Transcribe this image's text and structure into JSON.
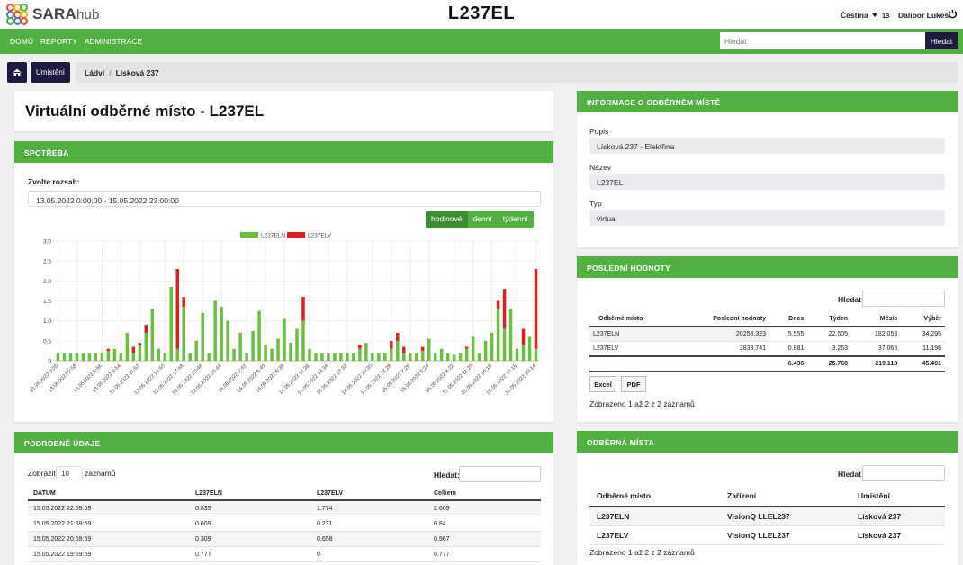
{
  "header": {
    "logo_strong": "SARA",
    "logo_light": "hub",
    "title": "L237EL",
    "language": "Čeština",
    "notification_count": "13",
    "user_name": "Dalibor Lukeš"
  },
  "nav": {
    "items": [
      "DOMŮ",
      "REPORTY",
      "ADMINISTRACE"
    ],
    "search_placeholder": "Hledat",
    "search_button": "Hledat"
  },
  "breadcrumb": {
    "locations_button": "Umístění",
    "items": [
      "Ládví",
      "Lísková 237"
    ]
  },
  "main": {
    "page_title": "Virtuální odběrné místo - L237EL"
  },
  "consumption": {
    "header": "SPOTŘEBA",
    "range_label": "Zvolte rozsah:",
    "range_value": "13.05.2022 0:00:00 - 15.05.2022 23:00:00",
    "toggles": [
      "hodinové",
      "denní",
      "týdenní"
    ],
    "active_toggle": "hodinové"
  },
  "chart_data": {
    "type": "bar",
    "stacked": true,
    "series": [
      {
        "name": "L237ELN",
        "color": "#6abf40",
        "values": [
          0.2,
          0.2,
          0.2,
          0.2,
          0.2,
          0.2,
          0.2,
          0.2,
          0.25,
          0.3,
          0.2,
          0.7,
          0.2,
          0.4,
          0.7,
          1.3,
          0.3,
          0.2,
          1.85,
          0.3,
          1.35,
          0.2,
          0.5,
          1.2,
          0.2,
          1.5,
          1.35,
          1.0,
          0.3,
          0.7,
          0.2,
          0.75,
          1.25,
          0.4,
          0.3,
          0.55,
          1.05,
          0.45,
          0.8,
          1.0,
          0.3,
          0.2,
          0.2,
          0.2,
          0.2,
          0.2,
          0.2,
          0.2,
          0.3,
          0.45,
          0.2,
          0.2,
          0.2,
          0.3,
          0.5,
          0.2,
          0.2,
          0.2,
          0.25,
          0.55,
          0.2,
          0.3,
          0.2,
          0.15,
          0.2,
          0.3,
          0.6,
          0.2,
          0.5,
          0.7,
          1.3,
          0.8,
          1.3,
          0.3,
          0.4,
          0.6,
          0.3
        ],
        "notes": "approximate hourly values"
      },
      {
        "name": "L237ELV",
        "color": "#e02020",
        "values": [
          0,
          0,
          0,
          0,
          0,
          0,
          0,
          0,
          0.05,
          0,
          0,
          0,
          0.15,
          0.05,
          0.2,
          0,
          0,
          0,
          0,
          2.0,
          0.25,
          0,
          0,
          0,
          0,
          0,
          0,
          0,
          0,
          0,
          0,
          0,
          0,
          0,
          0,
          0,
          0,
          0,
          0,
          0.6,
          0,
          0,
          0,
          0,
          0,
          0,
          0,
          0,
          0.1,
          0,
          0,
          0,
          0,
          0.2,
          0.2,
          0.15,
          0,
          0,
          0.1,
          0,
          0,
          0,
          0,
          0,
          0,
          0.05,
          0,
          0,
          0,
          0,
          0.2,
          1.0,
          0,
          0,
          0.4,
          0,
          2.0
        ],
        "notes": ""
      }
    ],
    "x_tick_labels": [
      "13.05.2022 0:00",
      "13.05.2022 2:58",
      "13.05.2022 5:56",
      "13.05.2022 8:54",
      "13.05.2022 11:52",
      "13.05.2022 14:50",
      "13.05.2022 17:48",
      "13.05.2022 20:46",
      "13.05.2022 23:44",
      "14.05.2022 2:42",
      "14.05.2022 5:40",
      "14.05.2022 8:38",
      "14.05.2022 11:36",
      "14.05.2022 14:34",
      "14.05.2022 17:32",
      "14.05.2022 20:30",
      "14.05.2022 23:28",
      "15.05.2022 2:26",
      "15.05.2022 5:24",
      "15.05.2022 8:22",
      "15.05.2022 11:20",
      "15.05.2022 14:18",
      "15.05.2022 17:16",
      "15.05.2022 20:14"
    ],
    "y_ticks": [
      "0",
      "0.5",
      "1.0",
      "1.5",
      "2.0",
      "2.5",
      "3.0"
    ],
    "ylim": [
      0,
      3.0
    ],
    "legend_position": "top-center"
  },
  "details": {
    "header": "PODROBNÉ ÚDAJE",
    "show_label": "Zobrazit",
    "page_size": "10",
    "records_label": "záznamů",
    "search_label": "Hledat:",
    "columns": [
      "DATUM",
      "L237ELN",
      "L237ELV",
      "Celkem"
    ],
    "rows": [
      [
        "15.05.2022 22:59:59",
        "0.835",
        "1.774",
        "2.609"
      ],
      [
        "15.05.2022 21:59:59",
        "0.609",
        "0.231",
        "0.84"
      ],
      [
        "15.05.2022 20:59:59",
        "0.309",
        "0.658",
        "0.967"
      ],
      [
        "15.05.2022 19:59:59",
        "0.777",
        "0",
        "0.777"
      ]
    ]
  },
  "info": {
    "header": "INFORMACE O ODBĚRNÉM MÍSTĚ",
    "fields": [
      {
        "label": "Popis",
        "value": "Lísková 237 - Elektřina"
      },
      {
        "label": "Název",
        "value": "L237EL"
      },
      {
        "label": "Typ",
        "value": "virtual"
      }
    ]
  },
  "last_values": {
    "header": "POSLEDNÍ HODNOTY",
    "search_label": "Hledat:",
    "columns": [
      "Odběrné místo",
      "Poslední hodnoty",
      "Dnes",
      "Týden",
      "Měsíc",
      "Výběr"
    ],
    "rows": [
      [
        "L237ELN",
        "20258.323",
        "5.555",
        "22.505",
        "182.053",
        "34.295"
      ],
      [
        "L237ELV",
        "3833.741",
        "0.881",
        "3.263",
        "37.065",
        "11.196"
      ]
    ],
    "totals": [
      "",
      "",
      "6.436",
      "25.768",
      "219.118",
      "45.491"
    ],
    "buttons": [
      "Excel",
      "PDF"
    ],
    "footer": "Zobrazeno 1 až 2 z 2 záznamů"
  },
  "points": {
    "header": "ODBĚRNÁ MÍSTA",
    "search_label": "Hledat:",
    "columns": [
      "Odběrné místo",
      "Zařízení",
      "Umístění"
    ],
    "rows": [
      [
        "L237ELN",
        "VisionQ LLEL237",
        "Lísková 237"
      ],
      [
        "L237ELV",
        "VisionQ LLEL237",
        "Lísková 237"
      ]
    ],
    "footer": "Zobrazeno 1 až 2 z 2 záznamů"
  }
}
